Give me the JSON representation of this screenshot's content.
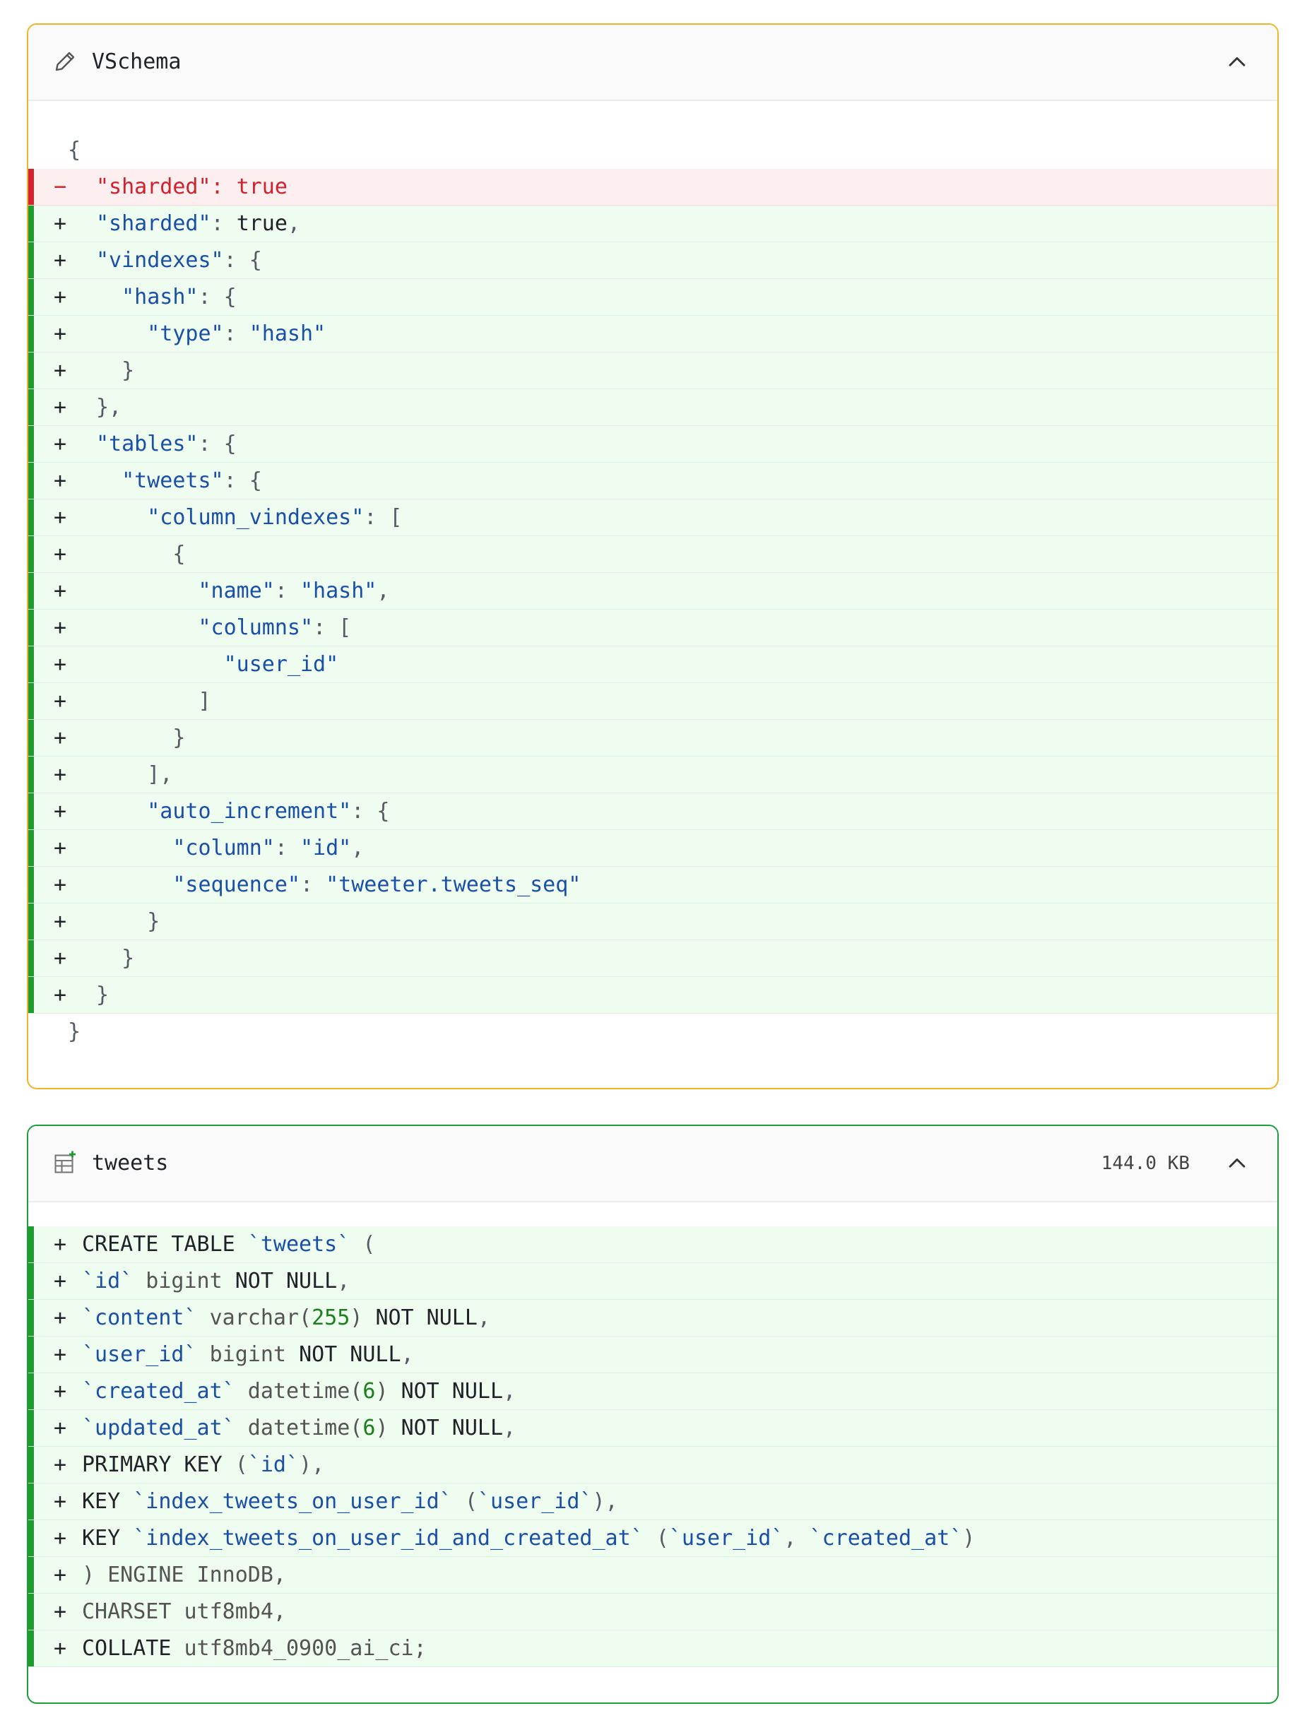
{
  "vschema": {
    "title": "VSchema",
    "icon": "pencil-icon",
    "collapse_icon": "chevron-up-icon",
    "border_color": "#f0b429",
    "diff": [
      {
        "kind": "ctx",
        "marker": "",
        "tokens": [
          [
            "p",
            "{"
          ]
        ]
      },
      {
        "kind": "del",
        "marker": "−",
        "tokens": [
          [
            "r",
            "\"sharded\": true"
          ]
        ]
      },
      {
        "kind": "add",
        "marker": "+",
        "tokens": [
          [
            "k",
            "\"sharded\""
          ],
          [
            "p",
            ": "
          ],
          [
            "b",
            "true"
          ],
          [
            "p",
            ","
          ]
        ]
      },
      {
        "kind": "add",
        "marker": "+",
        "tokens": [
          [
            "k",
            "\"vindexes\""
          ],
          [
            "p",
            ": {"
          ]
        ]
      },
      {
        "kind": "add",
        "marker": "+",
        "tokens": [
          [
            "p",
            "  "
          ],
          [
            "k",
            "\"hash\""
          ],
          [
            "p",
            ": {"
          ]
        ]
      },
      {
        "kind": "add",
        "marker": "+",
        "tokens": [
          [
            "p",
            "    "
          ],
          [
            "k",
            "\"type\""
          ],
          [
            "p",
            ": "
          ],
          [
            "s",
            "\"hash\""
          ]
        ]
      },
      {
        "kind": "add",
        "marker": "+",
        "tokens": [
          [
            "p",
            "  }"
          ]
        ]
      },
      {
        "kind": "add",
        "marker": "+",
        "tokens": [
          [
            "p",
            "},"
          ]
        ]
      },
      {
        "kind": "add",
        "marker": "+",
        "tokens": [
          [
            "k",
            "\"tables\""
          ],
          [
            "p",
            ": {"
          ]
        ]
      },
      {
        "kind": "add",
        "marker": "+",
        "tokens": [
          [
            "p",
            "  "
          ],
          [
            "k",
            "\"tweets\""
          ],
          [
            "p",
            ": {"
          ]
        ]
      },
      {
        "kind": "add",
        "marker": "+",
        "tokens": [
          [
            "p",
            "    "
          ],
          [
            "k",
            "\"column_vindexes\""
          ],
          [
            "p",
            ": ["
          ]
        ]
      },
      {
        "kind": "add",
        "marker": "+",
        "tokens": [
          [
            "p",
            "      {"
          ]
        ]
      },
      {
        "kind": "add",
        "marker": "+",
        "tokens": [
          [
            "p",
            "        "
          ],
          [
            "k",
            "\"name\""
          ],
          [
            "p",
            ": "
          ],
          [
            "s",
            "\"hash\""
          ],
          [
            "p",
            ","
          ]
        ]
      },
      {
        "kind": "add",
        "marker": "+",
        "tokens": [
          [
            "p",
            "        "
          ],
          [
            "k",
            "\"columns\""
          ],
          [
            "p",
            ": ["
          ]
        ]
      },
      {
        "kind": "add",
        "marker": "+",
        "tokens": [
          [
            "p",
            "          "
          ],
          [
            "s",
            "\"user_id\""
          ]
        ]
      },
      {
        "kind": "add",
        "marker": "+",
        "tokens": [
          [
            "p",
            "        ]"
          ]
        ]
      },
      {
        "kind": "add",
        "marker": "+",
        "tokens": [
          [
            "p",
            "      }"
          ]
        ]
      },
      {
        "kind": "add",
        "marker": "+",
        "tokens": [
          [
            "p",
            "    ],"
          ]
        ]
      },
      {
        "kind": "add",
        "marker": "+",
        "tokens": [
          [
            "p",
            "    "
          ],
          [
            "k",
            "\"auto_increment\""
          ],
          [
            "p",
            ": {"
          ]
        ]
      },
      {
        "kind": "add",
        "marker": "+",
        "tokens": [
          [
            "p",
            "      "
          ],
          [
            "k",
            "\"column\""
          ],
          [
            "p",
            ": "
          ],
          [
            "s",
            "\"id\""
          ],
          [
            "p",
            ","
          ]
        ]
      },
      {
        "kind": "add",
        "marker": "+",
        "tokens": [
          [
            "p",
            "      "
          ],
          [
            "k",
            "\"sequence\""
          ],
          [
            "p",
            ": "
          ],
          [
            "s",
            "\"tweeter.tweets_seq\""
          ]
        ]
      },
      {
        "kind": "add",
        "marker": "+",
        "tokens": [
          [
            "p",
            "    }"
          ]
        ]
      },
      {
        "kind": "add",
        "marker": "+",
        "tokens": [
          [
            "p",
            "  }"
          ]
        ]
      },
      {
        "kind": "add",
        "marker": "+",
        "tokens": [
          [
            "p",
            "}"
          ]
        ]
      },
      {
        "kind": "ctx",
        "marker": "",
        "tokens": [
          [
            "p",
            "}"
          ]
        ]
      }
    ]
  },
  "tweets": {
    "title": "tweets",
    "size": "144.0 KB",
    "icon": "table-add-icon",
    "collapse_icon": "chevron-up-icon",
    "border_color": "#1f9d3a",
    "diff": [
      {
        "kind": "add",
        "marker": "+",
        "tokens": [
          [
            "kw",
            "CREATE TABLE "
          ],
          [
            "s",
            "`tweets`"
          ],
          [
            "p",
            " ("
          ]
        ]
      },
      {
        "kind": "add",
        "marker": "+",
        "tokens": [
          [
            "s",
            "`id`"
          ],
          [
            "t",
            " bigint "
          ],
          [
            "kw",
            "NOT NULL"
          ],
          [
            "p",
            ","
          ]
        ]
      },
      {
        "kind": "add",
        "marker": "+",
        "tokens": [
          [
            "s",
            "`content`"
          ],
          [
            "t",
            " varchar("
          ],
          [
            "n",
            "255"
          ],
          [
            "t",
            ") "
          ],
          [
            "kw",
            "NOT NULL"
          ],
          [
            "p",
            ","
          ]
        ]
      },
      {
        "kind": "add",
        "marker": "+",
        "tokens": [
          [
            "s",
            "`user_id`"
          ],
          [
            "t",
            " bigint "
          ],
          [
            "kw",
            "NOT NULL"
          ],
          [
            "p",
            ","
          ]
        ]
      },
      {
        "kind": "add",
        "marker": "+",
        "tokens": [
          [
            "s",
            "`created_at`"
          ],
          [
            "t",
            " datetime("
          ],
          [
            "n",
            "6"
          ],
          [
            "t",
            ") "
          ],
          [
            "kw",
            "NOT NULL"
          ],
          [
            "p",
            ","
          ]
        ]
      },
      {
        "kind": "add",
        "marker": "+",
        "tokens": [
          [
            "s",
            "`updated_at`"
          ],
          [
            "t",
            " datetime("
          ],
          [
            "n",
            "6"
          ],
          [
            "t",
            ") "
          ],
          [
            "kw",
            "NOT NULL"
          ],
          [
            "p",
            ","
          ]
        ]
      },
      {
        "kind": "add",
        "marker": "+",
        "tokens": [
          [
            "kw",
            "PRIMARY KEY "
          ],
          [
            "p",
            "("
          ],
          [
            "s",
            "`id`"
          ],
          [
            "p",
            "),"
          ]
        ]
      },
      {
        "kind": "add",
        "marker": "+",
        "tokens": [
          [
            "kw",
            "KEY "
          ],
          [
            "s",
            "`index_tweets_on_user_id`"
          ],
          [
            "p",
            " ("
          ],
          [
            "s",
            "`user_id`"
          ],
          [
            "p",
            "),"
          ]
        ]
      },
      {
        "kind": "add",
        "marker": "+",
        "tokens": [
          [
            "kw",
            "KEY "
          ],
          [
            "s",
            "`index_tweets_on_user_id_and_created_at`"
          ],
          [
            "p",
            " ("
          ],
          [
            "s",
            "`user_id`"
          ],
          [
            "p",
            ", "
          ],
          [
            "s",
            "`created_at`"
          ],
          [
            "p",
            ")"
          ]
        ]
      },
      {
        "kind": "add",
        "marker": "+",
        "tokens": [
          [
            "t",
            ") ENGINE InnoDB,"
          ]
        ]
      },
      {
        "kind": "add",
        "marker": "+",
        "tokens": [
          [
            "t",
            "CHARSET utf8mb4,"
          ]
        ]
      },
      {
        "kind": "add",
        "marker": "+",
        "tokens": [
          [
            "kw",
            "COLLATE "
          ],
          [
            "t",
            "utf8mb4_0900_ai_ci;"
          ]
        ]
      }
    ]
  }
}
